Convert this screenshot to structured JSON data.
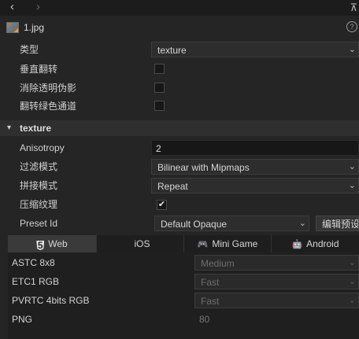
{
  "toolbar": {
    "back_glyph": "‹",
    "forward_glyph": "›",
    "pin_icon": "pin-icon"
  },
  "file": {
    "name": "1.jpg",
    "help_glyph": "?"
  },
  "properties": {
    "type_label": "类型",
    "type_value": "texture",
    "flip_vertical_label": "垂直翻转",
    "flip_vertical_checked": false,
    "remove_alpha_artifacts_label": "消除透明伪影",
    "remove_alpha_artifacts_checked": false,
    "flip_green_label": "翻转绿色通道",
    "flip_green_checked": false
  },
  "texture_section": {
    "title": "texture",
    "anisotropy_label": "Anisotropy",
    "anisotropy_value": "2",
    "filter_label": "过滤模式",
    "filter_value": "Bilinear with Mipmaps",
    "wrap_label": "拼接模式",
    "wrap_value": "Repeat",
    "compress_label": "压缩纹理",
    "compress_checked": true,
    "check_glyph": "✔",
    "preset_label": "Preset Id",
    "preset_value": "Default Opaque",
    "edit_preset_button": "编辑预设"
  },
  "platform_tabs": [
    {
      "label": "Web",
      "icon": "html5-icon",
      "glyph": "5"
    },
    {
      "label": "iOS",
      "icon": "apple-icon",
      "glyph": ""
    },
    {
      "label": "Mini Game",
      "icon": "gamepad-icon",
      "glyph": "🎮"
    },
    {
      "label": "Android",
      "icon": "android-icon",
      "glyph": "🤖"
    }
  ],
  "active_tab": "Web",
  "web_formats": [
    {
      "label": "ASTC 8x8",
      "value": "Medium"
    },
    {
      "label": "ETC1 RGB",
      "value": "Fast"
    },
    {
      "label": "PVRTC 4bits RGB",
      "value": "Fast"
    },
    {
      "label": "PNG",
      "value": "80"
    }
  ],
  "dropdown_glyph": "⌄",
  "section_caret": "▾"
}
